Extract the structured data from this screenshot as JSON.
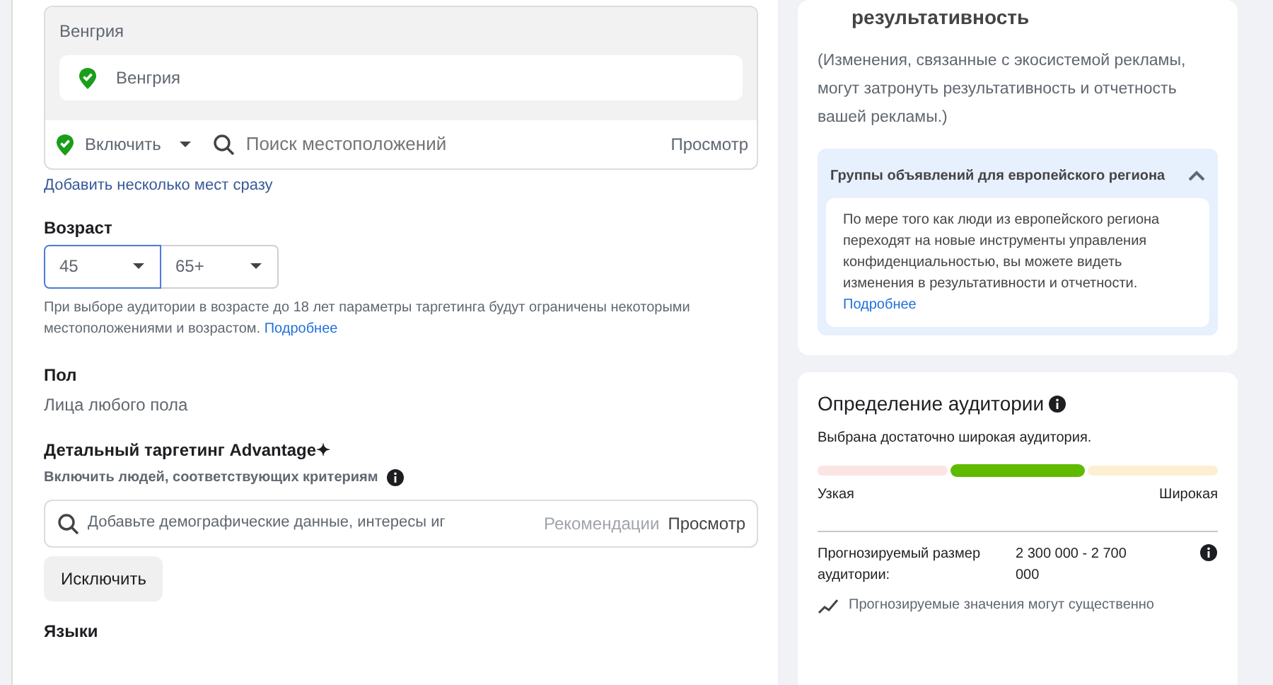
{
  "location": {
    "header": "Венгрия",
    "items": [
      {
        "name": "Венгрия"
      }
    ],
    "mode": "Включить",
    "search": {
      "placeholder": "Поиск местоположений"
    },
    "browse": "Просмотр",
    "bulk_link": "Добавить несколько мест сразу"
  },
  "age": {
    "label": "Возраст",
    "selects": [
      {
        "value": "45",
        "focused": true
      },
      {
        "value": "65+",
        "focused": false
      }
    ],
    "hint": "При выборе аудитории в возрасте до 18 лет параметры таргетинга будут ограничены некоторыми местоположениями и возрастом.",
    "hint_link": "Подробнее"
  },
  "gender": {
    "label": "Пол",
    "value": "Лица любого пола"
  },
  "detailed": {
    "label": "Детальный таргетинг Advantage✦",
    "sublabel": "Включить людей, соответствующих критериям",
    "search": {
      "placeholder": "Добавьте демографические данные, интересы иг"
    },
    "suggestions": "Рекомендации",
    "browse": "Просмотр",
    "exclude": "Исключить"
  },
  "languages": {
    "label": "Языки"
  },
  "impact": {
    "title": "результативность",
    "description": "(Изменения, связанные с экосистемой рекламы, могут затронуть результативность и отчетность вашей рекламы.)",
    "accordion": {
      "title": "Группы объявлений для европейского региона",
      "expanded": true,
      "body": "По мере того как люди из европейского региона переходят на новые инструменты управления конфиденциальностью, вы можете видеть изменения в результативности и отчетности.",
      "link": "Подробнее"
    }
  },
  "audience": {
    "title": "Определение аудитории",
    "status": "Выбрана достаточно широкая аудитория.",
    "segments": [
      {
        "color": "#fce4e4",
        "selected": false
      },
      {
        "color": "#5fba00",
        "selected": true
      },
      {
        "color": "#fdefd2",
        "selected": false
      }
    ],
    "min_label": "Узкая",
    "max_label": "Широкая",
    "size_label": "Прогнозируемый размер аудитории:",
    "size_value": "2 300 000 - 2 700 000",
    "note": "Прогнозируемые значения могут существенно"
  }
}
